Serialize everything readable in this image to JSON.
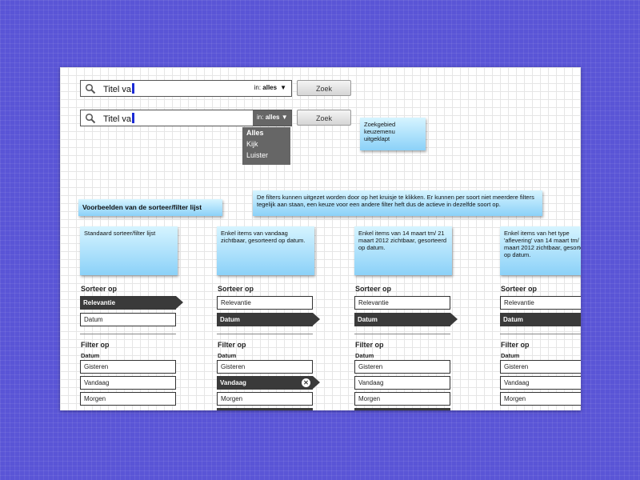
{
  "search1": {
    "value": "Titel va",
    "scope_prefix": "in:",
    "scope_value": "alles",
    "button": "Zoek"
  },
  "search2": {
    "value": "Titel va",
    "scope_prefix": "in:",
    "scope_value": "alles",
    "button": "Zoek",
    "options": [
      "Alles",
      "Kijk",
      "Luister"
    ]
  },
  "notes": {
    "dropdown_note": "Zoekgebied keuzemenu uitgeklapt",
    "section_title": "Voorbeelden van de sorteer/filter lijst",
    "filters_note": "De filters kunnen uitgezet worden door op het kruisje te klikken. Er kunnen per soort niet meerdere filters tegelijk aan staan, een keuze voor een andere filter heft dus de actieve in dezelfde soort op."
  },
  "columns": [
    {
      "note": "Standaard sorteer/filter lijst",
      "sort_heading": "Sorteer op",
      "sort": [
        "Relevantie",
        "Datum"
      ],
      "filter_heading": "Filter op",
      "filter_label": "Datum",
      "filters": [
        "Gisteren",
        "Vandaag",
        "Morgen"
      ]
    },
    {
      "note": "Enkel items van vandaag zichtbaar, gesorteerd op datum.",
      "sort_heading": "Sorteer op",
      "sort": [
        "Relevantie",
        "Datum"
      ],
      "filter_heading": "Filter op",
      "filter_label": "Datum",
      "filters": [
        "Gisteren",
        "Vandaag",
        "Morgen"
      ]
    },
    {
      "note": "Enkel items van 14 maart tm/ 21 maart 2012 zichtbaar, gesorteerd op datum.",
      "sort_heading": "Sorteer op",
      "sort": [
        "Relevantie",
        "Datum"
      ],
      "filter_heading": "Filter op",
      "filter_label": "Datum",
      "filters": [
        "Gisteren",
        "Vandaag",
        "Morgen"
      ]
    },
    {
      "note": "Enkel items van het type 'aflevering' van 14 maart tm/ 21 maart 2012 zichtbaar, gesorteerd op datum.",
      "sort_heading": "Sorteer op",
      "sort": [
        "Relevantie",
        "Datum"
      ],
      "filter_heading": "Filter op",
      "filter_label": "Datum",
      "filters": [
        "Gisteren",
        "Vandaag",
        "Morgen"
      ]
    }
  ],
  "icons": {
    "search": "search-icon",
    "dropdown": "triangle-down-icon",
    "remove": "close-icon"
  },
  "colors": {
    "background": "#5a55d6",
    "note": "#8bd1f8",
    "selected": "#3a3a3a",
    "caret": "#1b2bd6"
  }
}
